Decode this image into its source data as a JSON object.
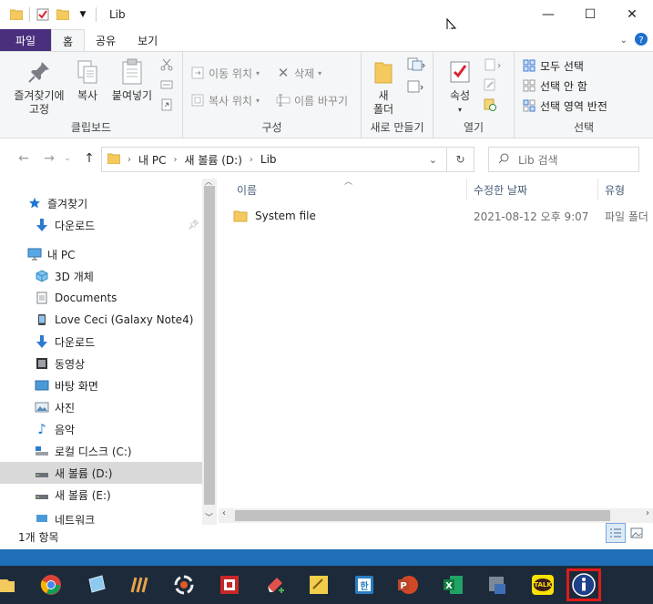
{
  "window": {
    "title": "Lib",
    "controls": {
      "minimize": "—",
      "maximize": "☐",
      "close": "✕"
    }
  },
  "ribbon_tabs": [
    {
      "label": "파일"
    },
    {
      "label": "홈"
    },
    {
      "label": "공유"
    },
    {
      "label": "보기"
    }
  ],
  "ribbon": {
    "clipboard": {
      "pin_label_line1": "즐겨찾기에",
      "pin_label_line2": "고정",
      "copy_label": "복사",
      "paste_label": "붙여넣기",
      "group_label": "클립보드"
    },
    "organize": {
      "move_to": "이동 위치",
      "copy_to": "복사 위치",
      "delete": "삭제",
      "rename": "이름 바꾸기",
      "group_label": "구성"
    },
    "new": {
      "new_folder_line1": "새",
      "new_folder_line2": "폴더",
      "group_label": "새로 만들기"
    },
    "open": {
      "properties": "속성",
      "group_label": "열기"
    },
    "select": {
      "select_all": "모두 선택",
      "select_none": "선택 안 함",
      "invert": "선택 영역 반전",
      "group_label": "선택"
    }
  },
  "address": {
    "breadcrumbs": [
      "내 PC",
      "새 볼륨 (D:)",
      "Lib"
    ],
    "search_placeholder": "Lib 검색"
  },
  "nav_pane": {
    "items": [
      {
        "label": "즐겨찾기",
        "icon": "star-icon"
      },
      {
        "label": "다운로드",
        "icon": "download-icon"
      },
      {
        "label": "내 PC",
        "icon": "pc-icon"
      },
      {
        "label": "3D 개체",
        "icon": "cube-icon"
      },
      {
        "label": "Documents",
        "icon": "document-icon"
      },
      {
        "label": "Love Ceci (Galaxy Note4)",
        "icon": "phone-icon"
      },
      {
        "label": "다운로드",
        "icon": "download-icon"
      },
      {
        "label": "동영상",
        "icon": "video-icon"
      },
      {
        "label": "바탕 화면",
        "icon": "desktop-icon"
      },
      {
        "label": "사진",
        "icon": "picture-icon"
      },
      {
        "label": "음악",
        "icon": "music-icon"
      },
      {
        "label": "로컬 디스크 (C:)",
        "icon": "drive-icon"
      },
      {
        "label": "새 볼륨 (D:)",
        "icon": "drive-icon",
        "selected": true
      },
      {
        "label": "새 볼륨 (E:)",
        "icon": "drive-icon"
      },
      {
        "label": "네트워크",
        "icon": "network-icon"
      }
    ]
  },
  "file_list": {
    "columns": [
      "이름",
      "수정한 날짜",
      "유형"
    ],
    "rows": [
      {
        "name": "System file",
        "modified": "2021-08-12 오후 9:07",
        "type": "파일 폴더"
      }
    ]
  },
  "status": {
    "item_count": "1개 항목"
  },
  "taskbar": {
    "apps": [
      "file-explorer-icon",
      "chrome-icon",
      "notepad-app-icon",
      "winamp-icon",
      "media-player-icon",
      "capture-app-icon",
      "eraser-app-icon",
      "sticky-notes-icon",
      "hangul-icon",
      "powerpoint-icon",
      "excel-icon",
      "settings-app-icon",
      "kakaotalk-icon",
      "info-app-icon"
    ],
    "kakao_label": "TALK",
    "hangul_label": "한"
  }
}
